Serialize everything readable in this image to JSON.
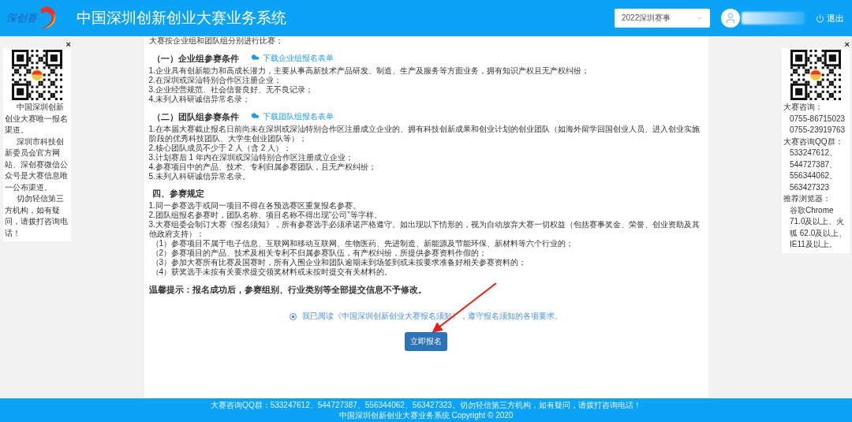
{
  "header": {
    "logo_text": "深创赛",
    "title": "中国深圳创新创业大赛业务系统",
    "season_select": {
      "value": "2022深圳赛事"
    },
    "logout": "退出"
  },
  "left_panel": {
    "close": "×",
    "paragraphs": [
      "中国深圳创新创业大赛唯一报名渠道。",
      "深圳市科技创新委员会官方网站、深创赛微信公众号是大赛信息唯一公布渠道。",
      "切勿轻信第三方机构，如有疑问，请拨打咨询电话！"
    ]
  },
  "right_panel": {
    "close": "×",
    "lines": [
      {
        "kind": "label",
        "text": "大赛咨询："
      },
      {
        "kind": "value",
        "text": "0755-86715023"
      },
      {
        "kind": "value",
        "text": "0755-23919763"
      },
      {
        "kind": "label",
        "text": "大赛咨询QQ群："
      },
      {
        "kind": "value",
        "text": "533247612、"
      },
      {
        "kind": "value",
        "text": "544727387、"
      },
      {
        "kind": "value",
        "text": "556344062、"
      },
      {
        "kind": "value",
        "text": "563427323"
      },
      {
        "kind": "label",
        "text": "推荐浏览器："
      },
      {
        "kind": "value",
        "text": "谷歌Chrome 71.0及以上、火狐 62.0及以上、IE11及以上。"
      }
    ]
  },
  "content": {
    "intro": "大赛按企业组和团队组分别进行比赛；",
    "sections": [
      {
        "heading": "（一）企业组参赛条件",
        "download_link": "下载企业组报名表单",
        "items": [
          {
            "kind": "item",
            "text": "1.企业具有创新能力和高成长潜力，主要从事高新技术产品研发、制造、生产及服务等方面业务，拥有知识产权且无产权纠纷；"
          },
          {
            "kind": "item",
            "text": "2.在深圳或深汕特别合作区注册企业；"
          },
          {
            "kind": "item",
            "text": "3.企业经营规范、社会信誉良好、无不良记录；"
          },
          {
            "kind": "item",
            "text": "4.未列入科研诚信异常名录；"
          }
        ]
      },
      {
        "heading": "（二）团队组参赛条件",
        "download_link": "下载团队组报名表单",
        "items": [
          {
            "kind": "item",
            "text": "1.在本届大赛截止报名日前尚未在深圳或深汕特别合作区注册成立企业的、拥有科技创新成果和创业计划的创业团队（如海外留学回国创业人员、进入创业实施阶段的优秀科技团队、大学生创业团队等）；"
          },
          {
            "kind": "item",
            "text": "2.核心团队成员不少于 2 人（含 2 人）；"
          },
          {
            "kind": "item",
            "text": "3.计划赛后 1 年内在深圳或深汕特别合作区注册成立企业；"
          },
          {
            "kind": "item",
            "text": "4.参赛项目中的产品、技术、专利归属参赛团队，且无产权纠纷；"
          },
          {
            "kind": "item",
            "text": "5.未列入科研诚信异常名录。"
          }
        ]
      },
      {
        "heading": "四、参赛规定",
        "items": [
          {
            "kind": "item",
            "text": "1.同一参赛选手或同一项目不得在各预选赛区重复报名参赛。"
          },
          {
            "kind": "item",
            "text": "2.团队组报名参赛时，团队名称、项目名称不得出现“公司”等字样。"
          },
          {
            "kind": "item",
            "text": "3.大赛组委会制订大赛《报名须知》，所有参赛选手必须承诺严格遵守。如出现以下情形的，视为自动放弃大赛一切权益（包括赛事奖金、荣誉、创业资助及其他政府支持）："
          },
          {
            "kind": "subitem",
            "text": "（1）参赛项目不属于电子信息、互联网和移动互联网、生物医药、先进制造、新能源及节能环保、新材料等六个行业的；"
          },
          {
            "kind": "subitem",
            "text": "（2）参赛项目的产品、技术及相关专利不归属参赛队伍，有产权纠纷，所提供参赛资料作假的；"
          },
          {
            "kind": "subitem",
            "text": "（3）参加大赛所有比赛及国赛时，所有入围企业和团队逾期未到场签到或未按要求准备好相关参赛资料的；"
          },
          {
            "kind": "subitem",
            "text": "（4）获奖选手未按有关要求提交领奖材料或未按时提交有关材料的。"
          }
        ]
      }
    ],
    "notice": "温馨提示：报名成功后，参赛组别、行业类别等全部提交信息不予修改。",
    "agreement": {
      "text": "我已阅读《中国深圳创新创业大赛报名须知》，遵守报名须知的各项要求。",
      "checked": true
    },
    "submit": "立即报名"
  },
  "footer": [
    "大赛咨询QQ群：533247612、544727387、556344062、563427323。切勿轻信第三方机构，如有疑问，请拨打咨询电话！",
    "中国深圳创新创业大赛业务系统 Copyright © 2020"
  ]
}
